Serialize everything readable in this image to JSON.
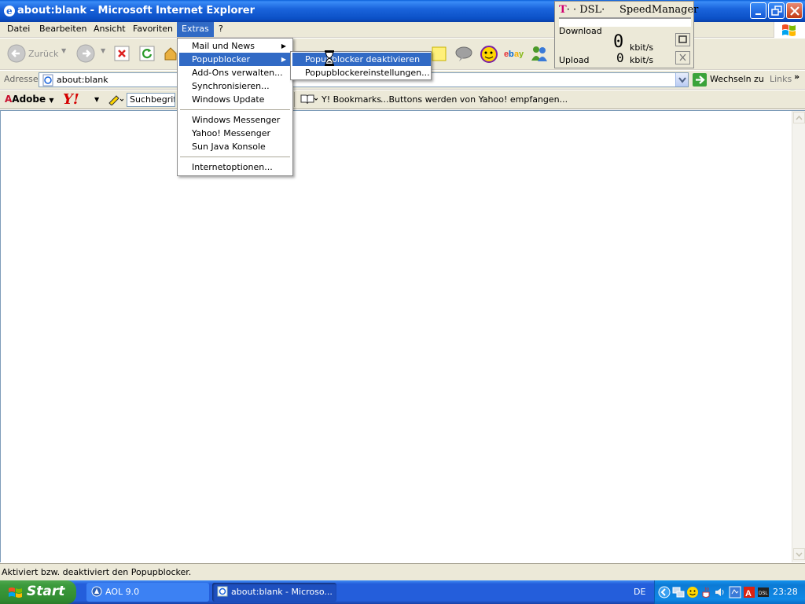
{
  "window": {
    "title": "about:blank - Microsoft Internet Explorer"
  },
  "menubar": {
    "items": [
      "Datei",
      "Bearbeiten",
      "Ansicht",
      "Favoriten",
      "Extras",
      "?"
    ],
    "active": "Extras"
  },
  "toolbar": {
    "back_label": "Zurück"
  },
  "address": {
    "label": "Adresse",
    "value": "about:blank",
    "go_label": "Wechseln zu",
    "links_label": "Links"
  },
  "addon_toolbar": {
    "adobe_label": "Adobe",
    "yahoo_logo": "Y!",
    "search_placeholder": "Suchbegriff",
    "bookmarks_label": "Y! Bookmarks",
    "status": "...Buttons werden von Yahoo! empfangen..."
  },
  "extras_menu": {
    "items": [
      {
        "label": "Mail und News",
        "submenu": true
      },
      {
        "label": "Popupblocker",
        "submenu": true,
        "highlighted": true
      },
      {
        "label": "Add-Ons verwalten..."
      },
      {
        "label": "Synchronisieren..."
      },
      {
        "label": "Windows Update"
      },
      {
        "label": "Windows Messenger"
      },
      {
        "label": "Yahoo! Messenger"
      },
      {
        "label": "Sun Java Konsole"
      },
      {
        "label": "Internetoptionen..."
      }
    ]
  },
  "popup_submenu": {
    "items": [
      {
        "label": "Popupblocker deaktivieren",
        "highlighted": true
      },
      {
        "label": "Popupblockereinstellungen..."
      }
    ]
  },
  "speed_manager": {
    "brand_prefix": "T",
    "brand_suffix": "· · DSL·",
    "title": "SpeedManager",
    "download_label": "Download",
    "download_value": "0",
    "download_unit": "kbit/s",
    "upload_label": "Upload",
    "upload_value": "0",
    "upload_unit": "kbit/s"
  },
  "statusbar": {
    "text": "Aktiviert bzw. deaktiviert den Popupblocker."
  },
  "taskbar": {
    "start_label": "Start",
    "tasks": [
      {
        "label": "AOL 9.0",
        "active": false
      },
      {
        "label": "about:blank - Microso...",
        "active": true
      }
    ],
    "language": "DE",
    "clock": "23:28"
  },
  "colors": {
    "menu_highlight": "#316ac5",
    "xp_face": "#ece9d8",
    "taskbar_blue": "#245edb",
    "start_green": "#3c9a3c"
  }
}
